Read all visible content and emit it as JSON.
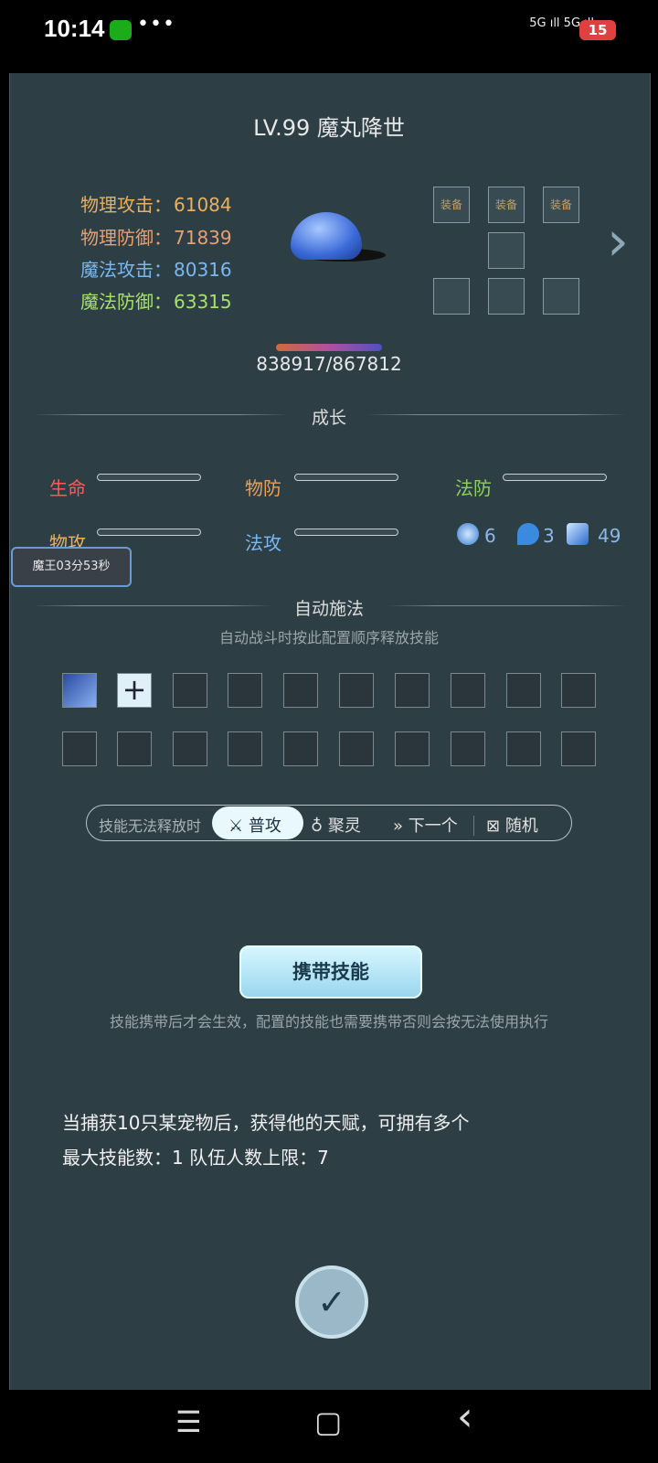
{
  "status_bar": {
    "time": "10:14",
    "dots": "•••",
    "signal": "5G ıll 5G ıll",
    "battery": "15"
  },
  "pet": {
    "title": "LV.99 魔丸降世",
    "hp_text": "838917/867812"
  },
  "stats": [
    {
      "label": "物理攻击：",
      "value": "61084",
      "color": "#e8b060"
    },
    {
      "label": "物理防御：",
      "value": "71839",
      "color": "#e8a070"
    },
    {
      "label": "魔法攻击：",
      "value": "80316",
      "color": "#7ab8f0"
    },
    {
      "label": "魔法防御：",
      "value": "63315",
      "color": "#a8e070"
    }
  ],
  "equipment": {
    "labels": [
      "装备",
      "装备",
      "装备"
    ]
  },
  "growth": {
    "title": "成长",
    "items": [
      {
        "label": "生命",
        "color": "#ff5a5a"
      },
      {
        "label": "物防",
        "color": "#e8a060"
      },
      {
        "label": "法防",
        "color": "#8ed060"
      },
      {
        "label": "物攻",
        "color": "#e8b060"
      },
      {
        "label": "法攻",
        "color": "#7ab8f0"
      }
    ],
    "resources": [
      "6",
      "3",
      "49"
    ]
  },
  "timer_badge": "魔王03分53秒",
  "auto_cast": {
    "title": "自动施法",
    "subtitle": "自动战斗时按此配置顺序释放技能",
    "add_symbol": "+"
  },
  "fallback": {
    "label": "技能无法释放时",
    "options": [
      "普攻",
      "聚灵",
      "下一个",
      "随机"
    ],
    "selected": "普攻"
  },
  "carry": {
    "button": "携带技能",
    "note": "技能携带后才会生效，配置的技能也需要携带否则会按无法使用执行"
  },
  "info": {
    "line1": "当捕获10只某宠物后，获得他的天赋，可拥有多个",
    "line2": "最大技能数：1   队伍人数上限：7"
  },
  "confirm_symbol": "✓",
  "nav": {
    "menu": "☰",
    "home": "▢",
    "back": "‹"
  }
}
